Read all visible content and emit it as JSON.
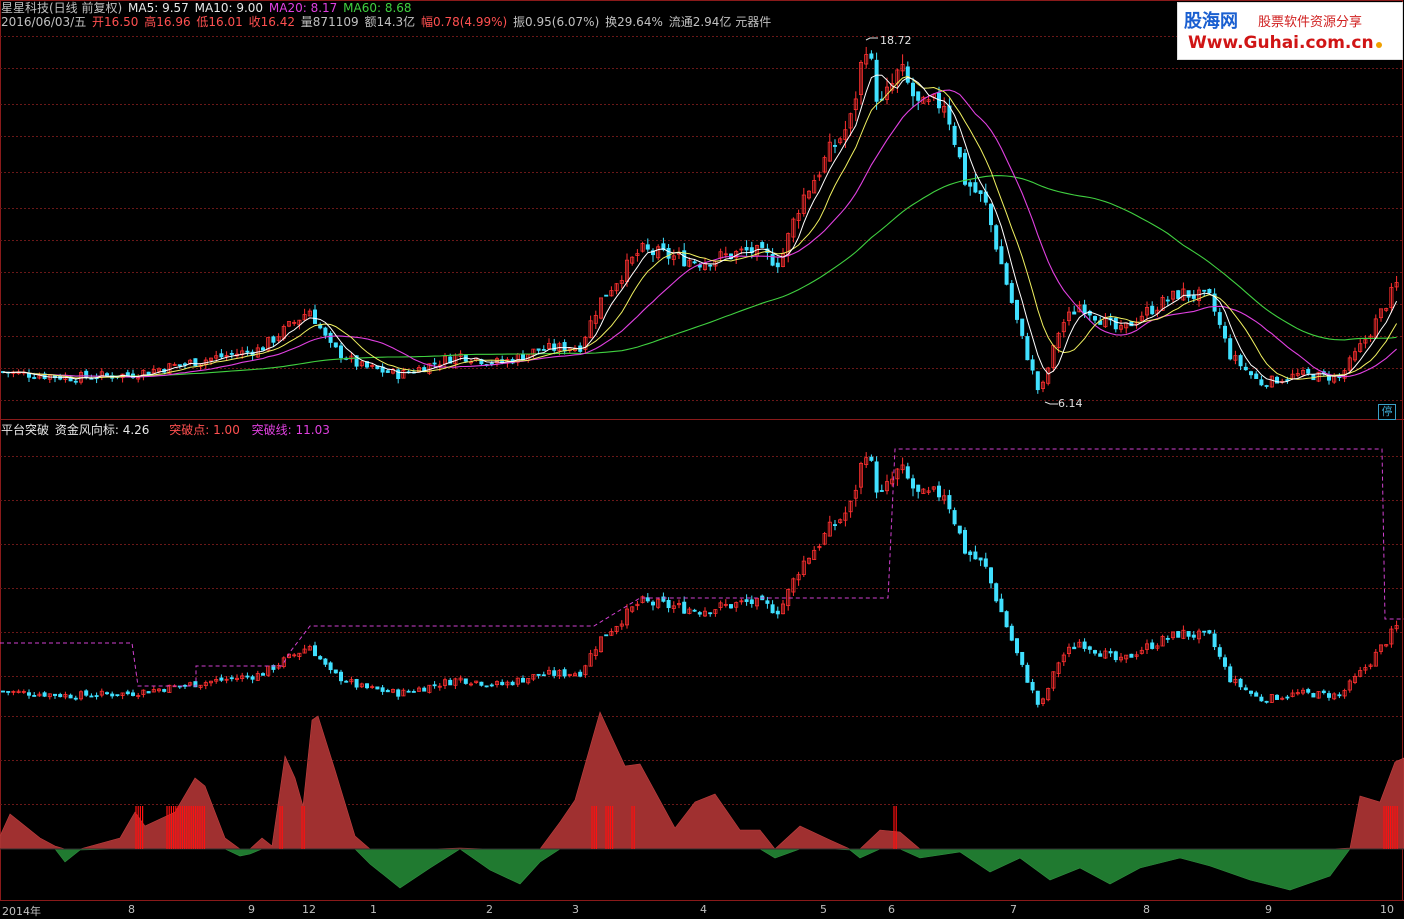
{
  "header": {
    "title": "星星科技(日线 前复权)",
    "ma5": "MA5: 9.57",
    "ma10": "MA10: 9.00",
    "ma20": "MA20: 8.17",
    "ma60": "MA60: 8.68",
    "date": "2016/06/03/五",
    "open": "开16.50",
    "high": "高16.96",
    "low": "低16.01",
    "close": "收16.42",
    "vol": "量871109",
    "amount": "额14.3亿",
    "change": "幅0.78(4.99%)",
    "amplitude": "振0.95(6.07%)",
    "turnover": "换29.64%",
    "float": "流通2.94亿 元器件"
  },
  "logo": {
    "name": "股海网",
    "tagline": "股票软件资源分享",
    "url": "Www.Guhai.com.cn"
  },
  "price_labels": {
    "max": "18.72",
    "min": "6.14"
  },
  "stop_icon_text": "停",
  "indicator_header": {
    "name": "平台突破",
    "fund_wind": "资金风向标: 4.26",
    "break_point": "突破点: 1.00",
    "break_line": "突破线: 11.03"
  },
  "x_axis": {
    "labels": [
      "2014年",
      "8",
      "9",
      "12",
      "1",
      "2",
      "3",
      "4",
      "5",
      "6",
      "7",
      "8",
      "9",
      "10"
    ]
  },
  "colors": {
    "up": "#ff3030",
    "down": "#40e0ff",
    "ma5": "#ffffff",
    "ma10": "#f0f060",
    "ma20": "#e040e0",
    "ma60": "#40d040",
    "pos_area": "#a03030",
    "neg_area": "#207a30",
    "grid": "#6a1818"
  },
  "chart_data": {
    "type": "candlestick",
    "price_key_points": [
      [
        0,
        7.0
      ],
      [
        70,
        6.8
      ],
      [
        130,
        6.9
      ],
      [
        200,
        7.4
      ],
      [
        260,
        7.8
      ],
      [
        310,
        9.2
      ],
      [
        330,
        7.9
      ],
      [
        360,
        7.2
      ],
      [
        400,
        6.9
      ],
      [
        460,
        7.6
      ],
      [
        500,
        7.3
      ],
      [
        540,
        7.8
      ],
      [
        580,
        7.9
      ],
      [
        600,
        9.5
      ],
      [
        640,
        11.3
      ],
      [
        700,
        10.9
      ],
      [
        750,
        11.3
      ],
      [
        780,
        10.9
      ],
      [
        800,
        13.0
      ],
      [
        830,
        14.8
      ],
      [
        850,
        15.8
      ],
      [
        866,
        18.72
      ],
      [
        880,
        16.3
      ],
      [
        900,
        17.7
      ],
      [
        920,
        16.3
      ],
      [
        945,
        16.6
      ],
      [
        965,
        13.8
      ],
      [
        985,
        13.0
      ],
      [
        1000,
        11.0
      ],
      [
        1020,
        8.4
      ],
      [
        1040,
        6.14
      ],
      [
        1060,
        8.6
      ],
      [
        1080,
        9.4
      ],
      [
        1100,
        8.9
      ],
      [
        1120,
        8.4
      ],
      [
        1140,
        9.0
      ],
      [
        1180,
        9.8
      ],
      [
        1210,
        9.6
      ],
      [
        1230,
        7.6
      ],
      [
        1260,
        6.6
      ],
      [
        1300,
        6.9
      ],
      [
        1340,
        6.8
      ],
      [
        1370,
        8.4
      ],
      [
        1400,
        10.3
      ]
    ]
  }
}
